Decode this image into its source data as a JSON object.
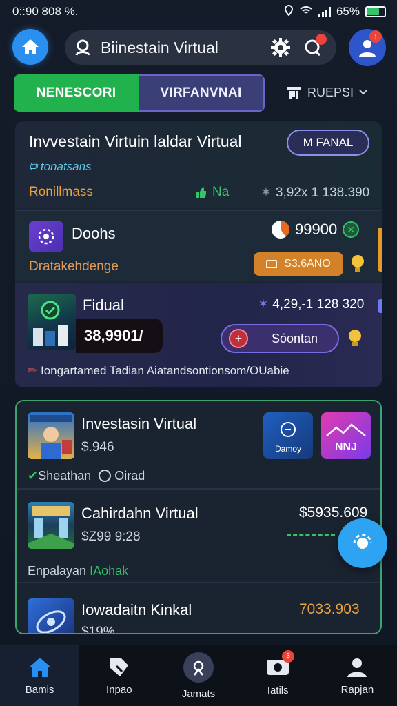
{
  "status_bar": {
    "time": "0:̈:90 808 %.",
    "battery": "65%"
  },
  "header": {
    "search_text": "Biinestain Virtual",
    "chat_badge": "",
    "profile_badge": "!"
  },
  "tabs": [
    {
      "label": "NENESCORI"
    },
    {
      "label": "VIRFANVNAI"
    }
  ],
  "filter": {
    "label": "RUEPSI"
  },
  "card1": {
    "title": "Invvestain Virtuin laldar Virtual",
    "manual_button": "M FANAL",
    "tag": "tonatsans",
    "row_left": "Ronillmass",
    "row_mid": "Na",
    "row_right": "3,92x 1 138.390",
    "doohs": {
      "name": "Doohs",
      "score": "99900",
      "sub": "Dratakehdenge",
      "pill": "S3.6ANO"
    },
    "findual": {
      "name": "Fidual",
      "score": "4,29,-1 128 320",
      "price": "38,9901/",
      "action": "Sóontan"
    },
    "note": "Iongartamed Tadian Aiatandsontionsom/OUabie"
  },
  "card2": {
    "items": [
      {
        "name": "Investasin Virtual",
        "sub": "$.946",
        "meta_a": "Sheathan",
        "meta_b": "Oirad",
        "app1": "Damoy",
        "app2": "NNJ"
      },
      {
        "name": "Cahirdahn Virtual",
        "sub": "$Z99 9:28",
        "price": "$5935.609",
        "meta_a": "Enpalayan",
        "meta_b": "IAohak"
      },
      {
        "name": "Iowadaitn Kinkal",
        "sub": "$19%",
        "price": "7033.903"
      }
    ]
  },
  "bottom_nav": [
    {
      "label": "Bamis",
      "icon": "home-icon"
    },
    {
      "label": "Inpao",
      "icon": "tag-icon"
    },
    {
      "label": "Jamats",
      "icon": "compass-icon"
    },
    {
      "label": "Iatils",
      "icon": "camera-icon",
      "badge": "3"
    },
    {
      "label": "Rapjan",
      "icon": "person-icon"
    }
  ],
  "colors": {
    "accent_blue": "#2b8ff0",
    "tab_green": "#22b24d",
    "tab_purple": "#3b3f78",
    "orange": "#e8a23e",
    "green": "#34c46a"
  }
}
